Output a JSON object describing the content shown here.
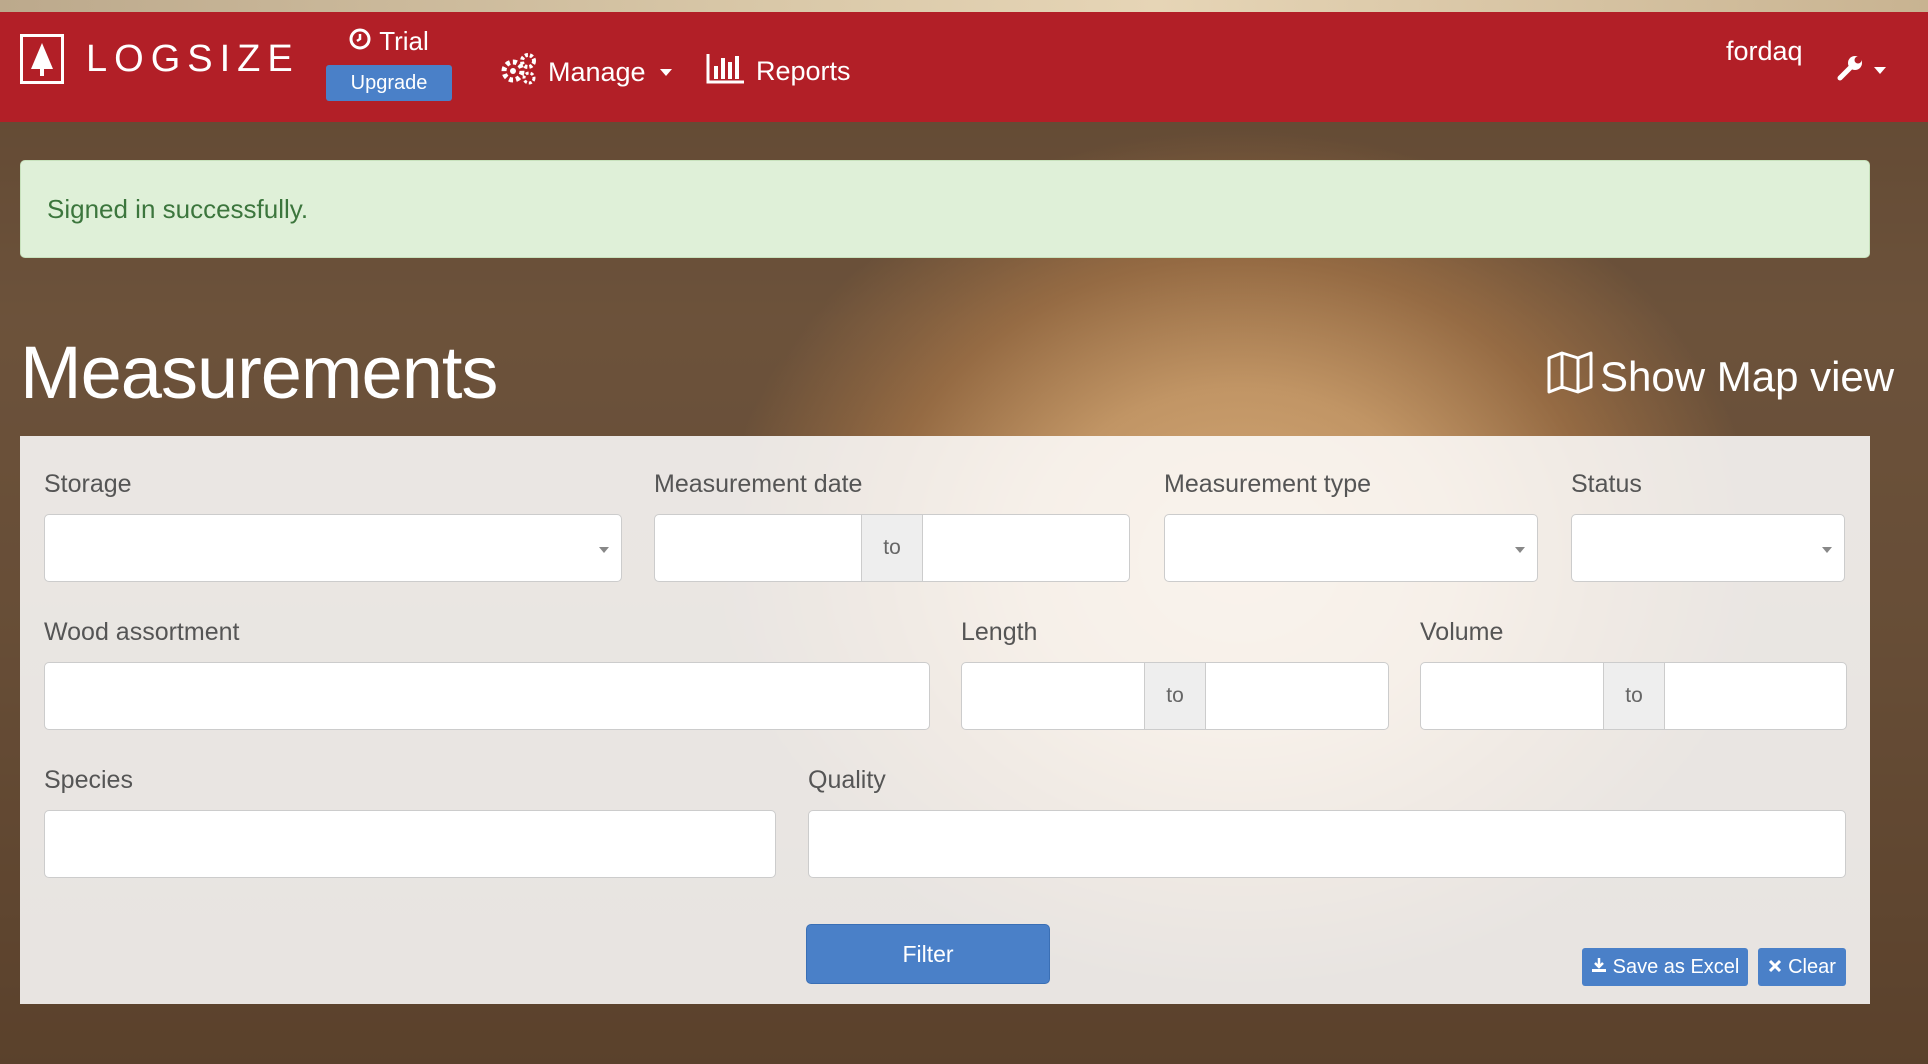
{
  "app": {
    "brand": "LOGSIZE",
    "trial_label": "Trial",
    "upgrade_label": "Upgrade"
  },
  "nav": {
    "manage_label": "Manage",
    "reports_label": "Reports",
    "user_name": "fordaq"
  },
  "alert": {
    "message": "Signed in successfully."
  },
  "page": {
    "title": "Measurements",
    "map_view_label": "Show Map view"
  },
  "filters": {
    "storage_label": "Storage",
    "measurement_date_label": "Measurement date",
    "measurement_type_label": "Measurement type",
    "status_label": "Status",
    "wood_assortment_label": "Wood assortment",
    "length_label": "Length",
    "volume_label": "Volume",
    "species_label": "Species",
    "quality_label": "Quality",
    "range_separator": "to"
  },
  "actions": {
    "filter_label": "Filter",
    "save_excel_label": "Save as Excel",
    "clear_label": "Clear"
  },
  "colors": {
    "navbar": "#b21f27",
    "accent": "#4a80c8",
    "alert_bg": "#dff0d8",
    "alert_text": "#3c763d"
  },
  "icons": [
    "brand-tree-icon",
    "clock-icon",
    "gears-icon",
    "bar-chart-icon",
    "wrench-icon",
    "map-icon",
    "download-icon",
    "close-icon"
  ]
}
